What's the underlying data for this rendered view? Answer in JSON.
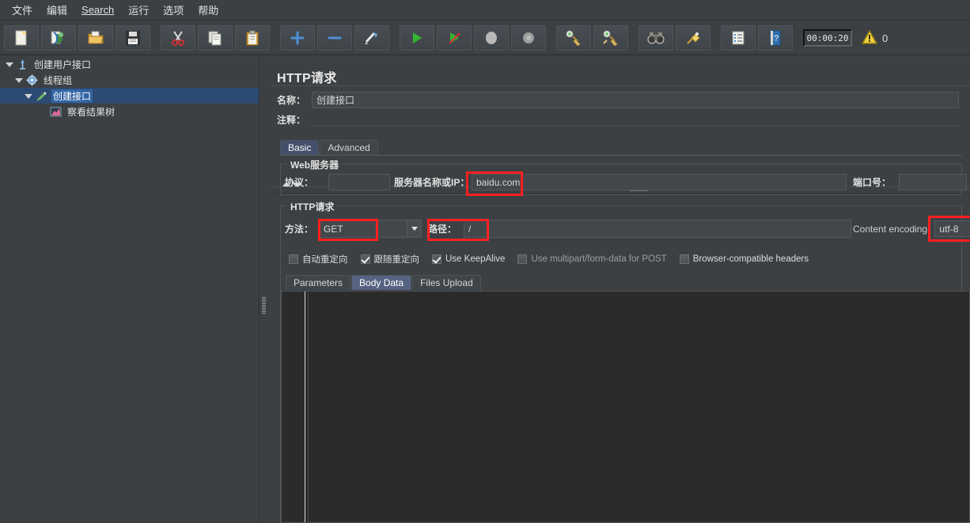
{
  "menubar": {
    "items": [
      {
        "label": "文件",
        "name": "menu-file"
      },
      {
        "label": "编辑",
        "name": "menu-edit"
      },
      {
        "label": "Search",
        "name": "menu-search",
        "underline_first": true
      },
      {
        "label": "运行",
        "name": "menu-run"
      },
      {
        "label": "选项",
        "name": "menu-options"
      },
      {
        "label": "帮助",
        "name": "menu-help"
      }
    ]
  },
  "toolbar": {
    "buttons": [
      {
        "icon": "new-file-icon",
        "name": "new-button"
      },
      {
        "icon": "templates-icon",
        "name": "templates-button"
      },
      {
        "icon": "open-folder-icon",
        "name": "open-button"
      },
      {
        "icon": "save-disk-icon",
        "name": "save-button"
      },
      {
        "icon": "cut-scissors-icon",
        "name": "cut-button"
      },
      {
        "icon": "copy-icon",
        "name": "copy-button"
      },
      {
        "icon": "paste-clipboard-icon",
        "name": "paste-button"
      },
      {
        "icon": "plus-icon",
        "name": "expand-button"
      },
      {
        "icon": "minus-icon",
        "name": "collapse-button"
      },
      {
        "icon": "toggle-icon",
        "name": "toggle-button"
      },
      {
        "icon": "start-play-icon",
        "name": "start-button"
      },
      {
        "icon": "start-no-pauses-icon",
        "name": "start-no-pauses-button"
      },
      {
        "icon": "stop-icon",
        "name": "stop-button"
      },
      {
        "icon": "shutdown-icon",
        "name": "shutdown-button"
      },
      {
        "icon": "clear-broom-icon",
        "name": "clear-button"
      },
      {
        "icon": "clear-all-broom-icon",
        "name": "clear-all-button"
      },
      {
        "icon": "binoculars-search-icon",
        "name": "search-button"
      },
      {
        "icon": "reset-search-icon",
        "name": "reset-search-button"
      },
      {
        "icon": "function-helper-icon",
        "name": "function-helper-button"
      },
      {
        "icon": "help-book-icon",
        "name": "help-button"
      }
    ],
    "timer": "00:00:20",
    "warning_count": "0",
    "warning_icon": "warning-triangle-icon"
  },
  "tree": {
    "nodes": [
      {
        "label": "创建用户接口",
        "depth": 1,
        "icon": "test-plan-icon",
        "expanded": true,
        "selected": false,
        "name": "tree-node-test-plan"
      },
      {
        "label": "线程组",
        "depth": 2,
        "icon": "thread-group-gear-icon",
        "expanded": true,
        "selected": false,
        "name": "tree-node-thread-group"
      },
      {
        "label": "创建接口",
        "depth": 3,
        "icon": "http-sampler-icon",
        "expanded": true,
        "selected": true,
        "name": "tree-node-http-request"
      },
      {
        "label": "察看结果树",
        "depth": 4,
        "icon": "view-results-tree-icon",
        "expanded": false,
        "selected": false,
        "name": "tree-node-view-results-tree"
      }
    ]
  },
  "main": {
    "title": "HTTP请求",
    "name_label": "名称：",
    "name_value": "创建接口",
    "comment_label": "注释：",
    "comment_value": "",
    "top_tabs": [
      {
        "label": "Basic",
        "active": true,
        "name": "tab-basic"
      },
      {
        "label": "Advanced",
        "active": false,
        "name": "tab-advanced"
      }
    ],
    "web_server": {
      "group_title": "Web服务器",
      "protocol_label": "协议：",
      "protocol_value": "",
      "server_label": "服务器名称或IP：",
      "server_value": "baidu.com",
      "port_label": "端口号：",
      "port_value": ""
    },
    "http_request": {
      "group_title": "HTTP请求",
      "method_label": "方法：",
      "method_value": "GET",
      "path_label": "路径：",
      "path_value": "/",
      "content_encoding_label": "Content encoding:",
      "content_encoding_value": "utf-8",
      "checkboxes": [
        {
          "label": "自动重定向",
          "checked": false,
          "dim": false,
          "name": "checkbox-auto-redirect"
        },
        {
          "label": "跟随重定向",
          "checked": true,
          "dim": false,
          "name": "checkbox-follow-redirect"
        },
        {
          "label": "Use KeepAlive",
          "checked": true,
          "dim": false,
          "name": "checkbox-keepalive"
        },
        {
          "label": "Use multipart/form-data for POST",
          "checked": false,
          "dim": true,
          "name": "checkbox-multipart"
        },
        {
          "label": "Browser-compatible headers",
          "checked": false,
          "dim": false,
          "name": "checkbox-browser-compatible-headers"
        }
      ],
      "body_tabs": [
        {
          "label": "Parameters",
          "active": false,
          "name": "tab-parameters"
        },
        {
          "label": "Body Data",
          "active": true,
          "name": "tab-body-data"
        },
        {
          "label": "Files Upload",
          "active": false,
          "name": "tab-files-upload"
        }
      ],
      "body_data_value": ""
    }
  },
  "annotations": {
    "highlight_color": "#ff2020",
    "boxes": [
      {
        "name": "annotation-box-server",
        "target": "server-name-field"
      },
      {
        "name": "annotation-box-method",
        "target": "method-combo"
      },
      {
        "name": "annotation-box-path",
        "target": "path-field"
      },
      {
        "name": "annotation-box-content-encoding",
        "target": "content-encoding-field"
      }
    ]
  }
}
